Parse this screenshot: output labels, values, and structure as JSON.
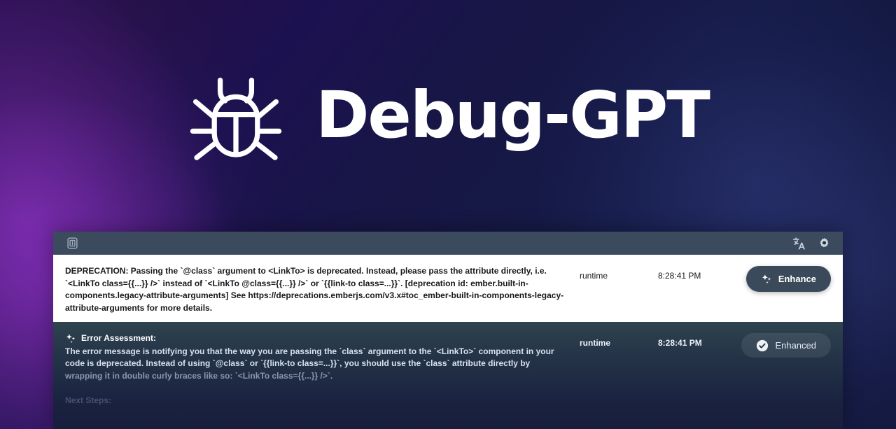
{
  "hero": {
    "logo_icon": "bug-icon",
    "title": "Debug-GPT"
  },
  "toolbar": {
    "clear_icon": "trash-icon",
    "clear_label": "Clear",
    "translate_icon": "translate-icon",
    "translate_label": "Translate",
    "settings_icon": "gear-icon",
    "settings_label": "Settings"
  },
  "log": {
    "rows": [
      {
        "kind": "error",
        "message": "DEPRECATION: Passing the `@class` argument to <LinkTo> is deprecated. Instead, please pass the attribute directly, i.e. `<LinkTo class={{...}} />` instead of `<LinkTo @class={{...}} />` or `{{link-to class=...}}`. [deprecation id: ember.built-in-components.legacy-attribute-arguments] See https://deprecations.emberjs.com/v3.x#toc_ember-built-in-components-legacy-attribute-arguments for more details.",
        "source": "runtime",
        "time": "8:28:41 PM",
        "action_label": "Enhance",
        "action_icon": "sparkle-icon",
        "action_state": "idle"
      },
      {
        "kind": "assessment",
        "heading_icon": "sparkle-icon",
        "heading": "Error Assessment:",
        "body_line_1": "The error message is notifying you that the way you are passing the `class` argument to the `<LinkTo>` component in your",
        "body_line_2": "code is deprecated. Instead of using `@class` or `{{link-to class=...}}`, you should use the `class` attribute directly by",
        "body_line_3": "wrapping it in double curly braces like so: `<LinkTo class={{...}} />`.",
        "next_steps": "Next Steps:",
        "source": "runtime",
        "time": "8:28:41 PM",
        "action_label": "Enhanced",
        "action_icon": "check-circle-icon",
        "action_state": "done"
      }
    ]
  },
  "colors": {
    "brand_purple": "#7b2cad",
    "background_navy": "#131840",
    "toolbar_light": "#3c4a5e",
    "toolbar_dark": "#1c3342",
    "button_enhance": "#3b4a5b",
    "text_white": "#ffffff"
  }
}
